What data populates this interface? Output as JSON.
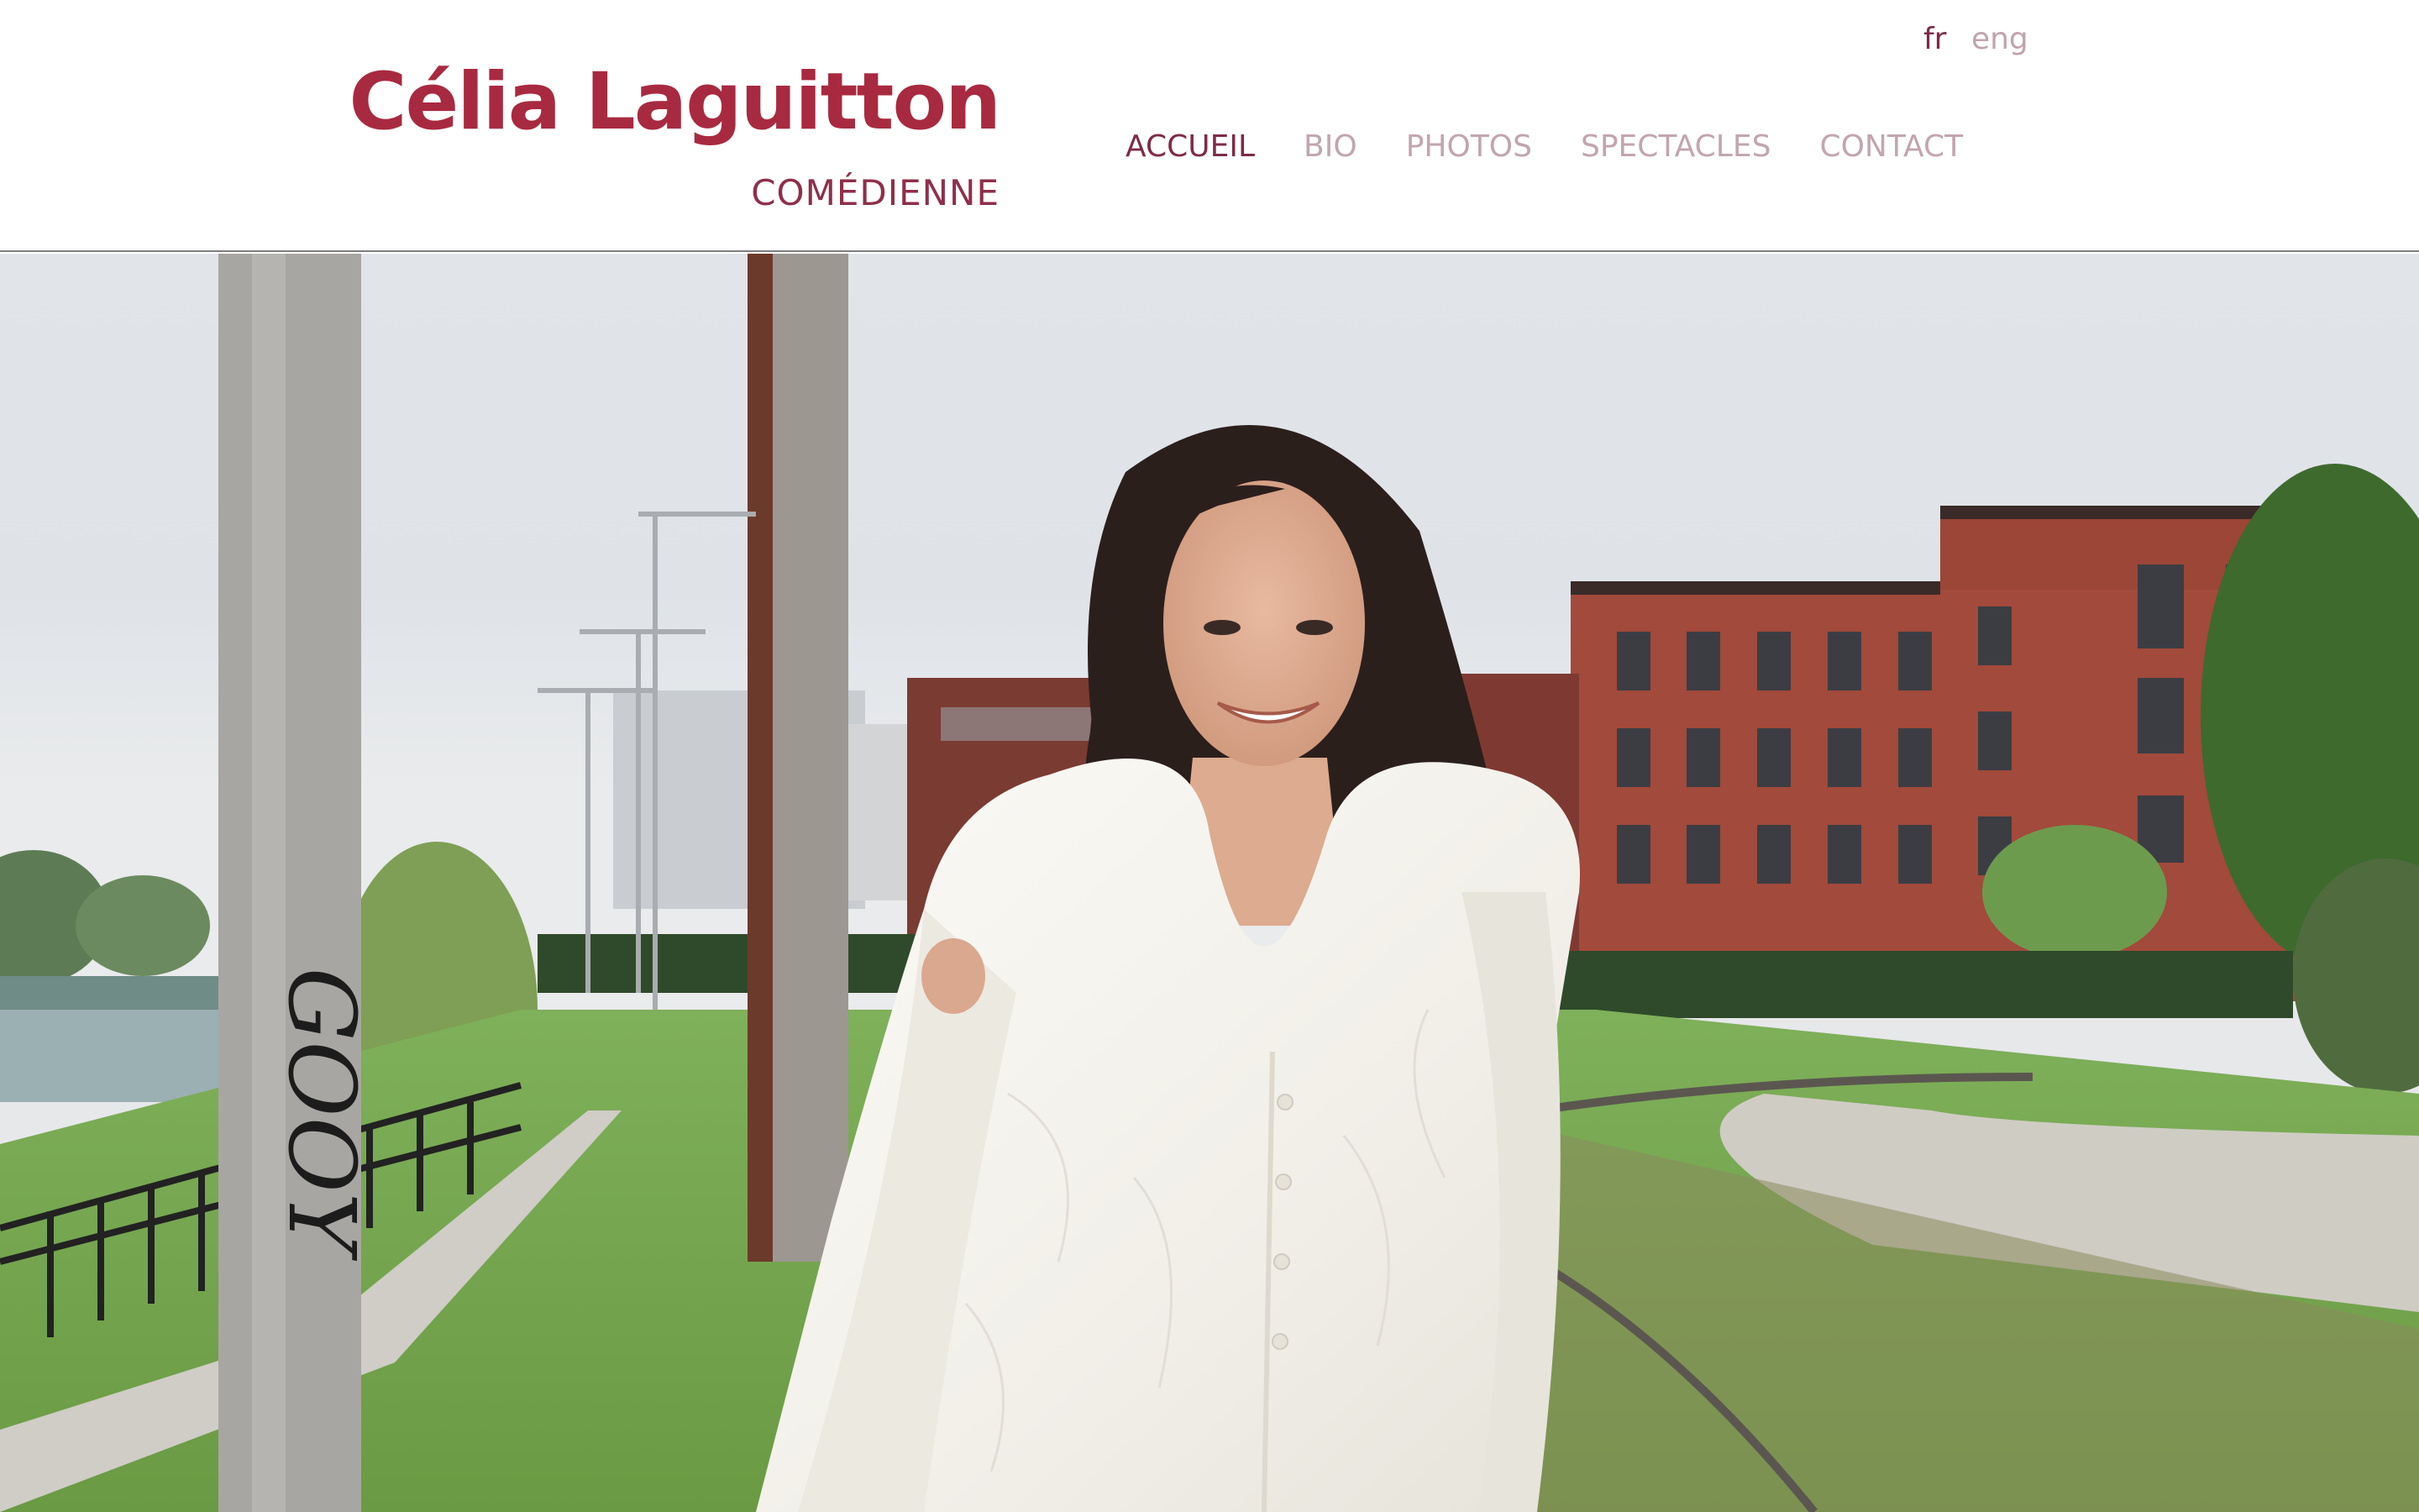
{
  "header": {
    "name": "Célia Laguitton",
    "subtitle": "COMÉDIENNE",
    "languages": [
      {
        "label": "fr",
        "active": true
      },
      {
        "label": "eng",
        "active": false
      }
    ],
    "nav": [
      {
        "label": "ACCUEIL",
        "active": true
      },
      {
        "label": "BIO",
        "active": false
      },
      {
        "label": "PHOTOS",
        "active": false
      },
      {
        "label": "SPECTACLES",
        "active": false
      },
      {
        "label": "CONTACT",
        "active": false
      }
    ]
  },
  "hero": {
    "graffiti": "GOOY",
    "colors": {
      "brand": "#a82a40",
      "nav_active": "#7d2b49",
      "nav_inactive": "#c2a5af"
    }
  }
}
